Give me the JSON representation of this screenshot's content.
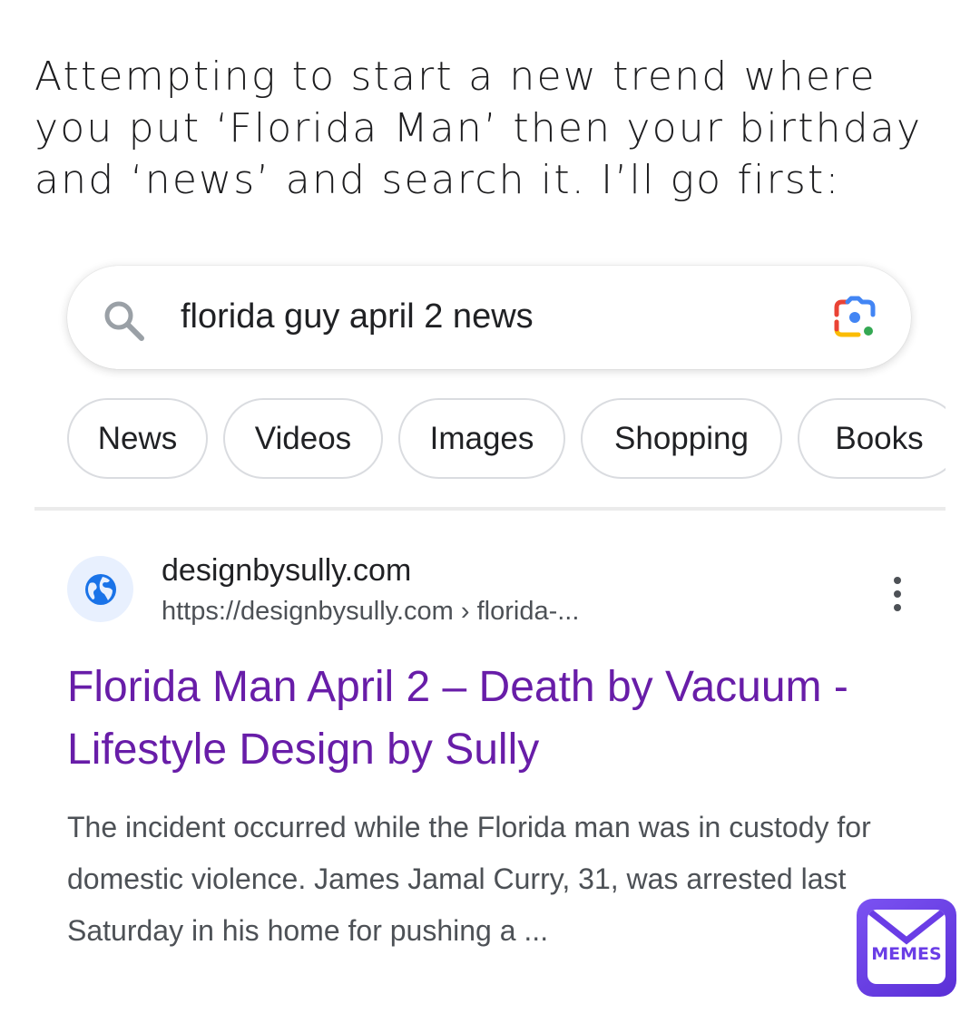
{
  "caption": "Attempting to start a new trend where you put ‘Florida Man’ then your birthday and ‘news’ and search it. I’ll go first:",
  "search": {
    "query": "florida guy april 2 news",
    "search_icon": "search-icon",
    "lens_icon": "google-lens-icon"
  },
  "chips": [
    "News",
    "Videos",
    "Images",
    "Shopping",
    "Books"
  ],
  "result": {
    "site_name": "designbysully.com",
    "url": "https://designbysully.com › florida-...",
    "title": "Florida Man April 2 – Death by Vacuum - Lifestyle Design by Sully",
    "snippet": "The incident occurred while the Florida man was in custody for domestic violence. James Jamal Curry, 31, was arrested last Saturday in his home for pushing a ...",
    "site_icon": "globe-icon",
    "menu_icon": "more-vert-icon"
  },
  "watermark": {
    "label": "MEMES"
  },
  "colors": {
    "title_link": "#681da8",
    "snippet": "#4d5156",
    "chip_border": "#dadce0",
    "globe": "#1a73e8",
    "watermark": "#6a3de6"
  }
}
